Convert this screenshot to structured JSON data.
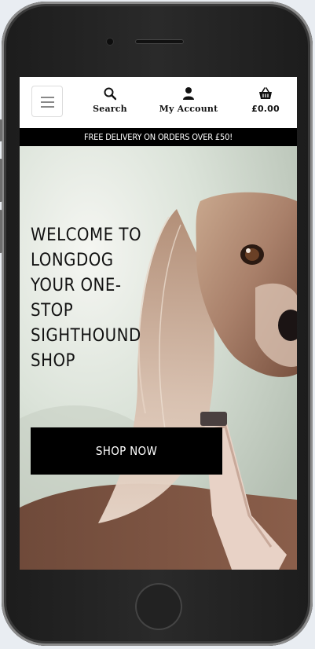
{
  "header": {
    "search_label": "Search",
    "account_label": "My Account",
    "basket_total": "£0.00"
  },
  "banner": {
    "text": "FREE DELIVERY ON ORDERS OVER £50!"
  },
  "hero": {
    "title_lines": [
      "WELCOME TO",
      "LONGDOG",
      "YOUR ONE-",
      "STOP",
      "SIGHTHOUND",
      "SHOP"
    ],
    "cta_label": "SHOP NOW"
  },
  "colors": {
    "banner_bg": "#000000",
    "cta_bg": "#000000",
    "text": "#111111"
  }
}
